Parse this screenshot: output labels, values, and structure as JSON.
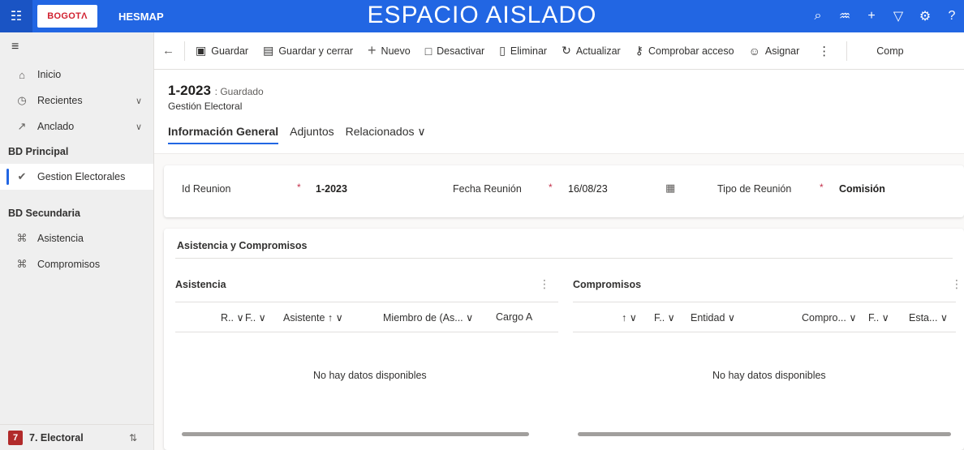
{
  "header": {
    "logo_text": "BOGOTΛ",
    "app_name": "HESMAP",
    "environment_title": "ESPACIO AISLADO",
    "icons": [
      "search-icon",
      "lightbulb-icon",
      "plus-icon",
      "filter-icon",
      "gear-icon",
      "help-icon"
    ]
  },
  "nav": {
    "top_items": [
      {
        "label": "Inicio",
        "icon": "home-icon"
      },
      {
        "label": "Recientes",
        "icon": "clock-icon"
      },
      {
        "label": "Anclado",
        "icon": "pin-icon"
      }
    ],
    "section_primary": "BD Principal",
    "primary_items": [
      {
        "label": "Gestion Electorales",
        "icon": "check-circle-icon"
      }
    ],
    "section_secondary": "BD Secundaria",
    "secondary_items": [
      {
        "label": "Asistencia",
        "icon": "puzzle-icon"
      },
      {
        "label": "Compromisos",
        "icon": "puzzle-icon"
      }
    ],
    "area": {
      "badge": "7",
      "label": "7. Electoral"
    }
  },
  "commands": {
    "save": "Guardar",
    "save_close": "Guardar y cerrar",
    "new": "Nuevo",
    "deactivate": "Desactivar",
    "delete": "Eliminar",
    "refresh": "Actualizar",
    "check_access": "Comprobar acceso",
    "assign": "Asignar",
    "overflow": "Comp"
  },
  "record": {
    "title": "1-2023",
    "status": ": Guardado",
    "entity": "Gestión Electoral"
  },
  "tabs": [
    {
      "label": "Información General",
      "active": true
    },
    {
      "label": "Adjuntos",
      "active": false
    },
    {
      "label": "Relacionados ∨",
      "active": false
    }
  ],
  "fields": {
    "id_label": "Id Reunion",
    "id_value": "1-2023",
    "date_label": "Fecha Reunión",
    "date_value": "16/08/23",
    "type_label": "Tipo de Reunión",
    "type_value": "Comisión",
    "required_mark": "*"
  },
  "section": {
    "title": "Asistencia y Compromisos",
    "asistencia": {
      "title": "Asistencia",
      "columns": [
        "R.. ∨",
        "F.. ∨",
        "Asistente ↑ ∨",
        "Miembro de (As... ∨",
        "Cargo A"
      ],
      "empty_text": "No hay datos disponibles"
    },
    "compromisos": {
      "title": "Compromisos",
      "columns": [
        "↑ ∨",
        "F.. ∨",
        "Entidad ∨",
        "Compro... ∨",
        "F.. ∨",
        "Esta... ∨"
      ],
      "empty_text": "No hay datos disponibles"
    }
  },
  "colors": {
    "header_blue": "#2266e3",
    "required_red": "#c4314b",
    "area_badge": "#b12a2a"
  }
}
